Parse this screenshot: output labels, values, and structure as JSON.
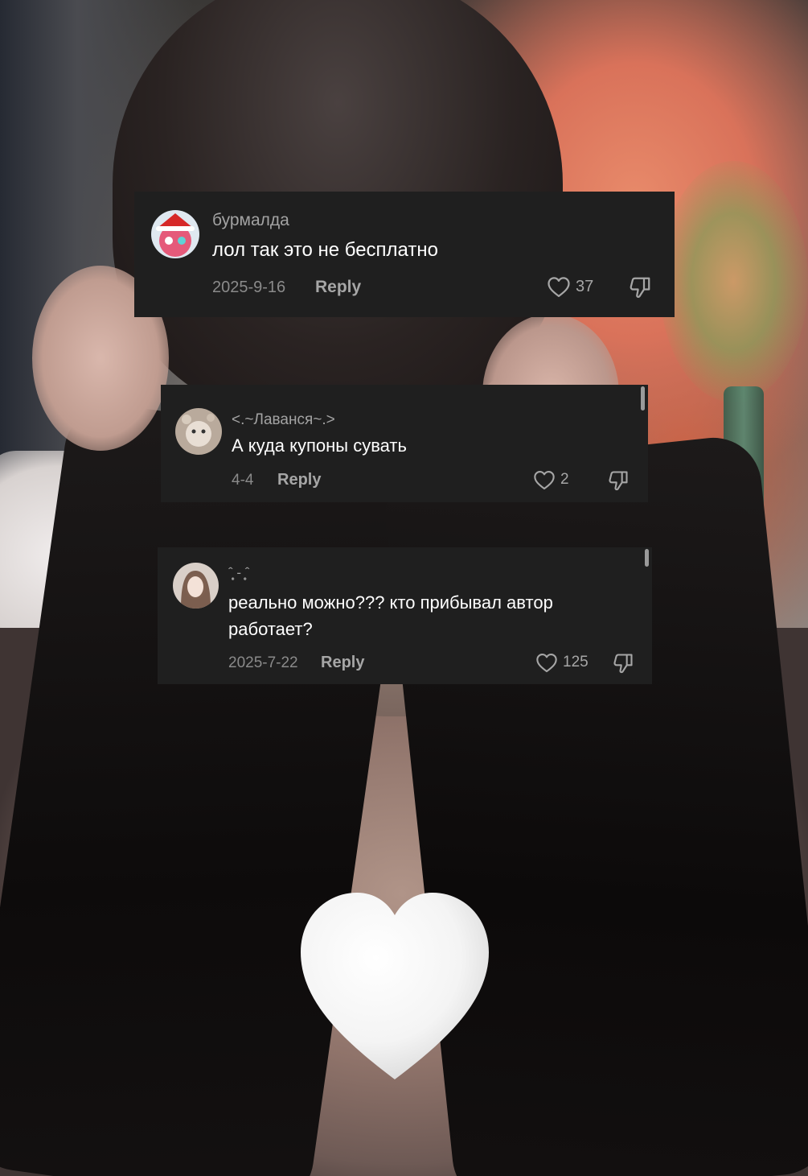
{
  "comments": [
    {
      "username": "бурмалда",
      "text": "лол так это не бесплатно",
      "date": "2025-9-16",
      "reply_label": "Reply",
      "likes": "37"
    },
    {
      "username": "<.~Лаванся~.>",
      "text": "А куда купоны сувать",
      "date": "4-4",
      "reply_label": "Reply",
      "likes": "2"
    },
    {
      "username": "ˆ̩̥ - ̩̥ˆ",
      "text": "реально можно??? кто прибывал автор работает?",
      "date": "2025-7-22",
      "reply_label": "Reply",
      "likes": "125"
    }
  ],
  "sticker": {
    "icon": "white-heart-icon"
  },
  "colors": {
    "card_bg": "#1f1f1f",
    "username": "#a3a3a3",
    "meta": "#8a8a8a",
    "text": "#ffffff"
  }
}
